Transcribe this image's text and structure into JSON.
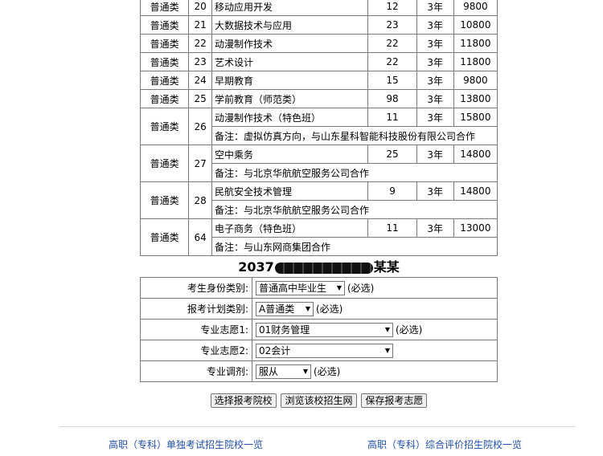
{
  "majors": [
    {
      "category": "普通类",
      "no": "20",
      "name": "移动应用开发",
      "plan": "12",
      "years": "3年",
      "fee": "9800"
    },
    {
      "category": "普通类",
      "no": "21",
      "name": "大数据技术与应用",
      "plan": "23",
      "years": "3年",
      "fee": "10800"
    },
    {
      "category": "普通类",
      "no": "22",
      "name": "动漫制作技术",
      "plan": "22",
      "years": "3年",
      "fee": "11800"
    },
    {
      "category": "普通类",
      "no": "23",
      "name": "艺术设计",
      "plan": "22",
      "years": "3年",
      "fee": "11800"
    },
    {
      "category": "普通类",
      "no": "24",
      "name": "早期教育",
      "plan": "15",
      "years": "3年",
      "fee": "9800"
    },
    {
      "category": "普通类",
      "no": "25",
      "name": "学前教育（师范类）",
      "plan": "98",
      "years": "3年",
      "fee": "13800"
    },
    {
      "category": "普通类",
      "no": "26",
      "name": "动漫制作技术（特色班）",
      "plan": "11",
      "years": "3年",
      "fee": "15800",
      "note": "备注：虚拟仿真方向，与山东星科智能科技股份有限公司合作"
    },
    {
      "category": "普通类",
      "no": "27",
      "name": "空中乘务",
      "plan": "25",
      "years": "3年",
      "fee": "14800",
      "note": "备注：与北京华航航空服务公司合作"
    },
    {
      "category": "普通类",
      "no": "28",
      "name": "民航安全技术管理",
      "plan": "9",
      "years": "3年",
      "fee": "14800",
      "note": "备注：与北京华航航空服务公司合作"
    },
    {
      "category": "普通类",
      "no": "64",
      "name": "电子商务（特色班）",
      "plan": "11",
      "years": "3年",
      "fee": "13000",
      "note": "备注：与山东网商集团合作"
    }
  ],
  "applicant": {
    "id_prefix": "2037",
    "name_suffix": "某某"
  },
  "form": {
    "identity": {
      "label": "考生身份类别:",
      "value": "普通高中毕业生",
      "required": "(必选)"
    },
    "plan": {
      "label": "报考计划类别:",
      "value": "A普通类",
      "required": "(必选)"
    },
    "choice1": {
      "label": "专业志愿1:",
      "value": "01财务管理",
      "required": "(必选)"
    },
    "choice2": {
      "label": "专业志愿2:",
      "value": "02会计"
    },
    "adjust": {
      "label": "专业调剂:",
      "value": "服从",
      "required": "(必选)"
    }
  },
  "buttons": {
    "choose": "选择报考院校",
    "browse": "浏览该校招生网",
    "save": "保存报考志愿"
  },
  "links": {
    "single": "高职（专科）单独考试招生院校一览",
    "comprehensive": "高职（专科）综合评价招生院校一览"
  }
}
